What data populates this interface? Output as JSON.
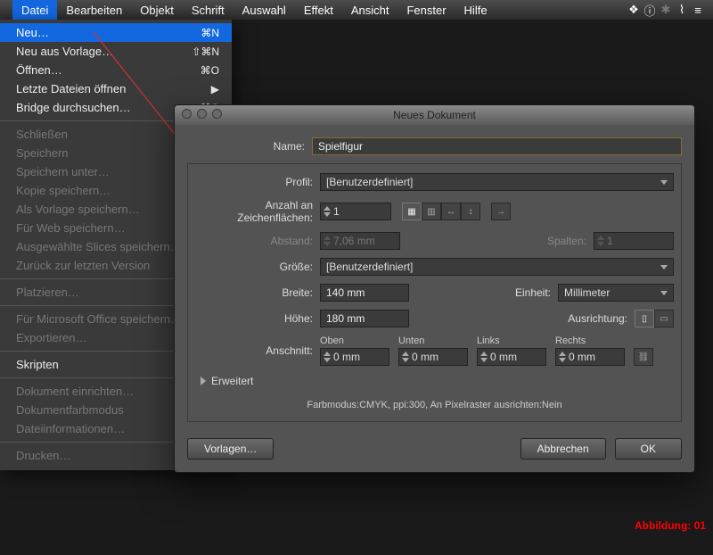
{
  "menubar": {
    "items": [
      "Datei",
      "Bearbeiten",
      "Objekt",
      "Schrift",
      "Auswahl",
      "Effekt",
      "Ansicht",
      "Fenster",
      "Hilfe"
    ],
    "status_icons": [
      "sync-icon",
      "info-icon",
      "bluetooth-icon",
      "wifi-icon",
      "menu-icon"
    ]
  },
  "file_menu": {
    "items": [
      {
        "label": "Neu…",
        "shortcut": "⌘N",
        "hl": true
      },
      {
        "label": "Neu aus Vorlage…",
        "shortcut": "⇧⌘N"
      },
      {
        "label": "Öffnen…",
        "shortcut": "⌘O"
      },
      {
        "label": "Letzte Dateien öffnen",
        "shortcut": "▶"
      },
      {
        "label": "Bridge durchsuchen…",
        "shortcut": "⌥⌘O"
      },
      {
        "sep": true
      },
      {
        "label": "Schließen",
        "disabled": true
      },
      {
        "label": "Speichern",
        "disabled": true
      },
      {
        "label": "Speichern unter…",
        "disabled": true
      },
      {
        "label": "Kopie speichern…",
        "disabled": true
      },
      {
        "label": "Als Vorlage speichern…",
        "disabled": true
      },
      {
        "label": "Für Web speichern…",
        "disabled": true
      },
      {
        "label": "Ausgewählte Slices speichern…",
        "disabled": true
      },
      {
        "label": "Zurück zur letzten Version",
        "disabled": true
      },
      {
        "sep": true
      },
      {
        "label": "Platzieren…",
        "disabled": true
      },
      {
        "sep": true
      },
      {
        "label": "Für Microsoft Office speichern…",
        "disabled": true
      },
      {
        "label": "Exportieren…",
        "disabled": true
      },
      {
        "sep": true
      },
      {
        "label": "Skripten"
      },
      {
        "sep": true
      },
      {
        "label": "Dokument einrichten…",
        "disabled": true
      },
      {
        "label": "Dokumentfarbmodus",
        "disabled": true
      },
      {
        "label": "Dateiinformationen…",
        "disabled": true
      },
      {
        "sep": true
      },
      {
        "label": "Drucken…",
        "disabled": true
      }
    ]
  },
  "dialog": {
    "title": "Neues Dokument",
    "name_label": "Name:",
    "name_value": "Spielfigur",
    "profile_label": "Profil:",
    "profile_value": "[Benutzerdefiniert]",
    "artboards_label": "Anzahl an Zeichenflächen:",
    "artboards_value": "1",
    "spacing_label": "Abstand:",
    "spacing_value": "7,06 mm",
    "columns_label": "Spalten:",
    "columns_value": "1",
    "size_label": "Größe:",
    "size_value": "[Benutzerdefiniert]",
    "width_label": "Breite:",
    "width_value": "140 mm",
    "unit_label": "Einheit:",
    "unit_value": "Millimeter",
    "height_label": "Höhe:",
    "height_value": "180 mm",
    "orientation_label": "Ausrichtung:",
    "bleed_label": "Anschnitt:",
    "bleed": {
      "top_label": "Oben",
      "top": "0 mm",
      "bottom_label": "Unten",
      "bottom": "0 mm",
      "left_label": "Links",
      "left": "0 mm",
      "right_label": "Rechts",
      "right": "0 mm"
    },
    "advanced_label": "Erweitert",
    "summary": "Farbmodus:CMYK, ppi:300, An Pixelraster ausrichten:Nein",
    "templates_btn": "Vorlagen…",
    "cancel_btn": "Abbrechen",
    "ok_btn": "OK"
  },
  "caption": "Abbildung: 01"
}
